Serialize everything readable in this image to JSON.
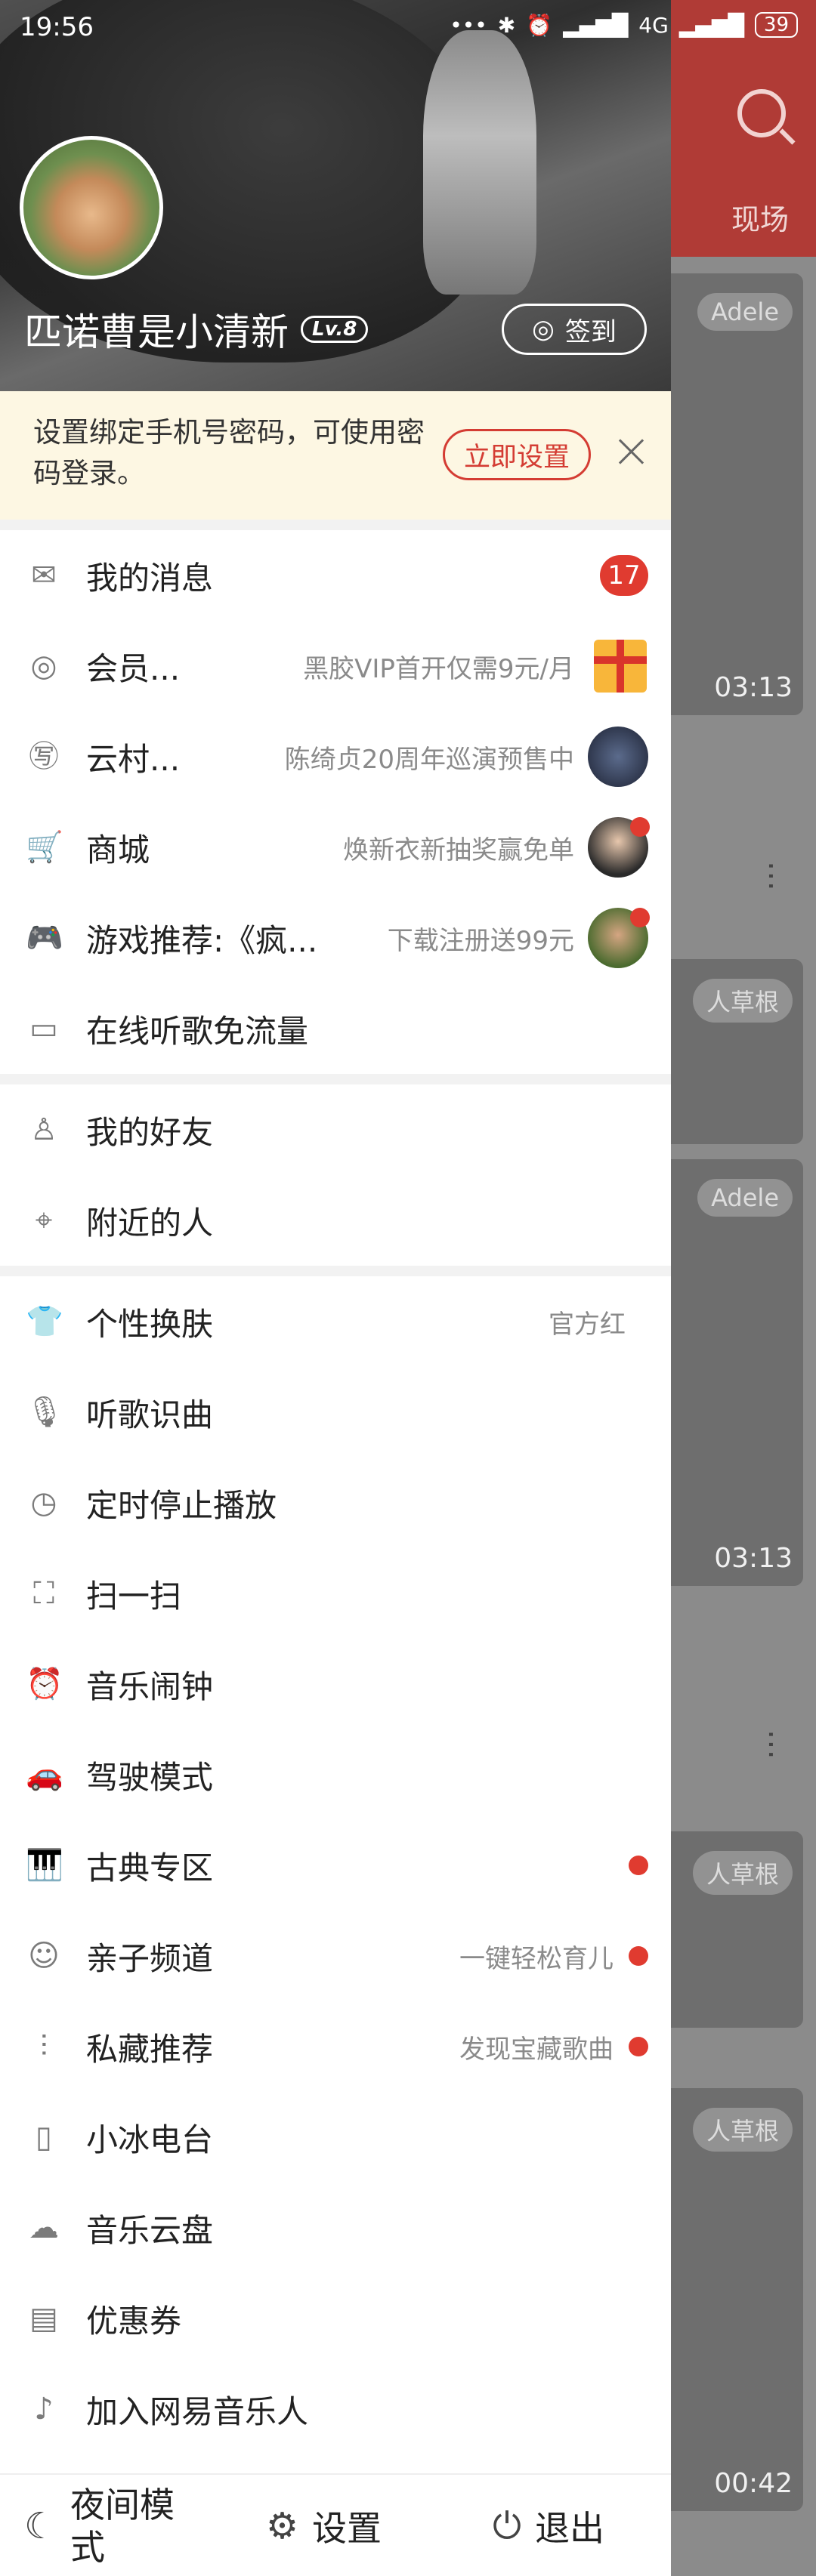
{
  "status": {
    "time": "19:56",
    "network": "4G",
    "battery": "39"
  },
  "background": {
    "tab": "现场",
    "tag_adele": "Adele",
    "tag_caogen": "人草根",
    "durations": [
      "03:13",
      "03:13",
      "00:42"
    ]
  },
  "profile": {
    "name": "匹诺曹是小清新",
    "level": "Lv.8",
    "signin_label": "签到"
  },
  "notice": {
    "text": "设置绑定手机号密码，可使用密码登录。",
    "action": "立即设置"
  },
  "section1": [
    {
      "label": "我的消息",
      "icon": "mail-icon",
      "badge": "17"
    },
    {
      "label": "会员...",
      "icon": "vinyl-icon",
      "sub": "黑胶VIP首开仅需9元/月"
    },
    {
      "label": "云村...",
      "icon": "ticket-icon",
      "sub": "陈绮贞20周年巡演预售中"
    },
    {
      "label": "商城",
      "icon": "cart-icon",
      "sub": "焕新衣新抽奖赢免单"
    },
    {
      "label": "游戏推荐:《疯...",
      "icon": "gamepad-icon",
      "sub": "下载注册送99元"
    },
    {
      "label": "在线听歌免流量",
      "icon": "sim-icon"
    }
  ],
  "section2": [
    {
      "label": "我的好友",
      "icon": "person-icon"
    },
    {
      "label": "附近的人",
      "icon": "location-icon"
    }
  ],
  "section3": [
    {
      "label": "个性换肤",
      "icon": "shirt-icon",
      "sub": "官方红"
    },
    {
      "label": "听歌识曲",
      "icon": "mic-icon"
    },
    {
      "label": "定时停止播放",
      "icon": "clock-icon"
    },
    {
      "label": "扫一扫",
      "icon": "scan-icon"
    },
    {
      "label": "音乐闹钟",
      "icon": "alarm-icon"
    },
    {
      "label": "驾驶模式",
      "icon": "car-icon"
    },
    {
      "label": "古典专区",
      "icon": "piano-icon"
    },
    {
      "label": "亲子频道",
      "icon": "baby-icon",
      "sub": "一键轻松育儿"
    },
    {
      "label": "私藏推荐",
      "icon": "waveform-icon",
      "sub": "发现宝藏歌曲"
    },
    {
      "label": "小冰电台",
      "icon": "popsicle-icon"
    },
    {
      "label": "音乐云盘",
      "icon": "cloud-icon"
    },
    {
      "label": "优惠券",
      "icon": "coupon-icon"
    },
    {
      "label": "加入网易音乐人",
      "icon": "music-note-icon"
    }
  ],
  "footer": {
    "night": "夜间模式",
    "settings": "设置",
    "logout": "退出"
  }
}
